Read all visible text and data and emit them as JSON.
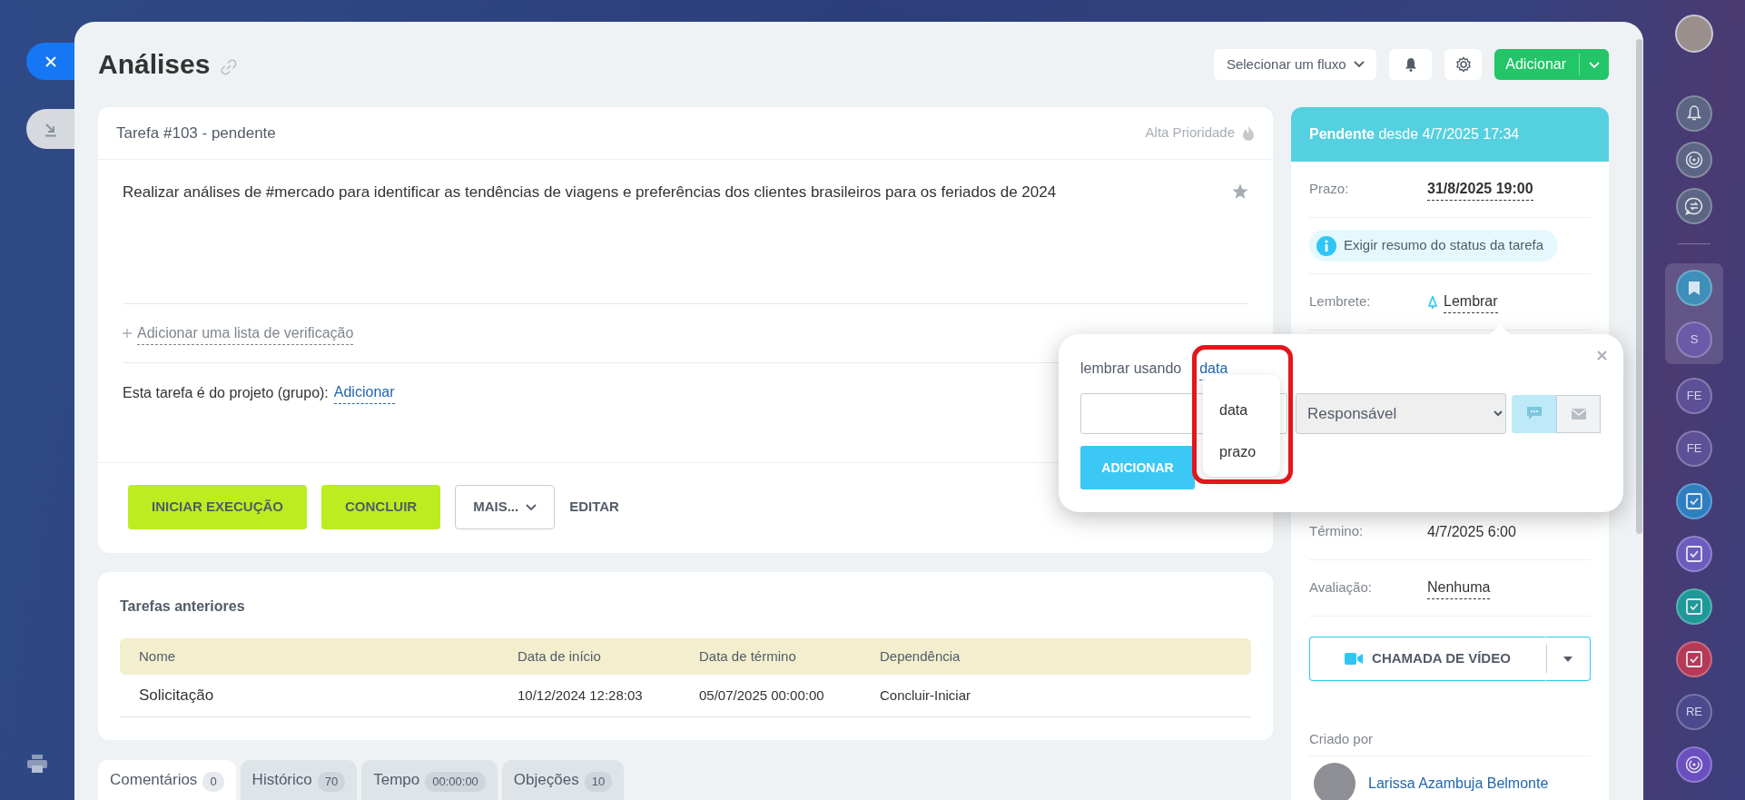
{
  "header": {
    "title": "Análises",
    "flow_select": "Selecionar um fluxo",
    "add_button": "Adicionar"
  },
  "task": {
    "heading": "Tarefa #103 - pendente",
    "priority": "Alta Prioridade",
    "high_priority": false,
    "starred": false,
    "description": "Realizar análises de #mercado para identificar as tendências de viagens e preferências dos clientes brasileiros para os feriados de 2024",
    "checklist_link": "Adicionar uma lista de verificação",
    "project_label": "Esta tarefa é do projeto (grupo):",
    "project_link": "Adicionar",
    "actions": [
      {
        "label": "INICIAR EXECUÇÃO",
        "kind": "primary"
      },
      {
        "label": "CONCLUIR",
        "kind": "primary"
      },
      {
        "label": "MAIS...",
        "kind": "dropdown"
      },
      {
        "label": "EDITAR",
        "kind": "link"
      }
    ]
  },
  "previous_tasks": {
    "title": "Tarefas anteriores",
    "columns": [
      "Nome",
      "Data de início",
      "Data de término",
      "Dependência"
    ],
    "rows": [
      [
        "Solicitação",
        "10/12/2024 12:28:03",
        "05/07/2025 00:00:00",
        "Concluir-Iniciar"
      ]
    ]
  },
  "tabs": [
    {
      "label": "Comentários",
      "count": "0",
      "selected": true
    },
    {
      "label": "Histórico",
      "count": "70",
      "selected": false
    },
    {
      "label": "Tempo",
      "count": "00:00:00",
      "selected": false
    },
    {
      "label": "Objeções",
      "count": "10",
      "selected": false
    }
  ],
  "sidebar": {
    "status": "**Pendente** desde 4/7/2025 17:34",
    "fields": [
      {
        "kind": "editable",
        "label": "Prazo:",
        "value": "31/8/2025 19:00"
      },
      {
        "kind": "notice",
        "value": "Exigir resumo do status da tarefa"
      },
      {
        "kind": "reminder",
        "label": "Lembrete:",
        "value": "Lembrar"
      },
      {
        "kind": "plain",
        "label": "Término:",
        "value": "4/7/2025 6:00"
      },
      {
        "kind": "editable",
        "label": "Avaliação:",
        "value": "Nenhuma"
      }
    ],
    "video_call": "CHAMADA DE VÍDEO",
    "created_by_label": "Criado por",
    "created_by": "Larissa Azambuja Belmonte"
  },
  "reminder_popup": {
    "prefix": "lembrar usando",
    "mode": "data",
    "options": [
      "data",
      "prazo"
    ],
    "recipient": "Responsável",
    "channels": [
      {
        "kind": "chat",
        "selected": true
      },
      {
        "kind": "email",
        "selected": false
      }
    ],
    "submit": "ADICIONAR"
  },
  "rail": [
    {
      "kind": "avatar",
      "pinned": false
    },
    {
      "kind": "bell",
      "pinned": false
    },
    {
      "kind": "swirl",
      "pinned": false
    },
    {
      "kind": "chat",
      "pinned": false
    },
    {
      "kind": "divider",
      "pinned": false
    },
    {
      "kind": "bookmark",
      "color": "#3e8fba",
      "pinned": true
    },
    {
      "kind": "initials",
      "initials": "S",
      "color": "#6a5aa8",
      "pinned": true
    },
    {
      "kind": "initials",
      "initials": "FE",
      "color": "#5d5096",
      "pinned": false
    },
    {
      "kind": "initials",
      "initials": "FE",
      "color": "#5d5096",
      "pinned": false
    },
    {
      "kind": "task",
      "color": "#2e7fc1",
      "pinned": false
    },
    {
      "kind": "task",
      "color": "#6b5cbd",
      "pinned": false
    },
    {
      "kind": "task",
      "color": "#1f9898",
      "pinned": false
    },
    {
      "kind": "task",
      "color": "#b43a58",
      "pinned": false
    },
    {
      "kind": "initials",
      "initials": "RE",
      "color": "#4c4a8c",
      "pinned": false
    },
    {
      "kind": "swirl",
      "color": "#6a4fc0",
      "pinned": false
    }
  ]
}
